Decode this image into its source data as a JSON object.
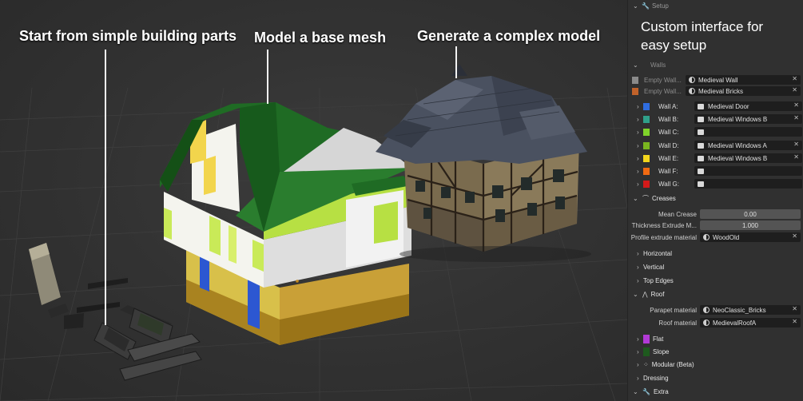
{
  "captions": {
    "parts": "Start from simple building parts",
    "mesh": "Model a base mesh",
    "complex": "Generate a complex model",
    "interface_line1": "Custom interface for",
    "interface_line2": "easy setup"
  },
  "panel": {
    "setup_header": "Setup",
    "walls_header": "Walls",
    "empty_rows": [
      {
        "label": "Empty Wall...",
        "value": "Medieval Wall",
        "color": "#8a8a8a"
      },
      {
        "label": "Empty Wall...",
        "value": "Medieval Bricks",
        "color": "#c0622a"
      }
    ],
    "walls": [
      {
        "label": "Wall A:",
        "value": "Medieval Door",
        "color": "#2f6de0"
      },
      {
        "label": "Wall B:",
        "value": "Medieval Windows B",
        "color": "#2fa08a"
      },
      {
        "label": "Wall C:",
        "value": "",
        "color": "#7fd42a"
      },
      {
        "label": "Wall D:",
        "value": "Medieval Windows A",
        "color": "#7ab51f"
      },
      {
        "label": "Wall E:",
        "value": "Medieval Windows B",
        "color": "#f2d51c"
      },
      {
        "label": "Wall F:",
        "value": "",
        "color": "#f06a12"
      },
      {
        "label": "Wall G:",
        "value": "",
        "color": "#d41a1a"
      }
    ],
    "creases": {
      "header": "Creases",
      "mean_crease_label": "Mean Crease",
      "mean_crease_value": "0.00",
      "thickness_label": "Thickness Extrude M...",
      "thickness_value": "1.000",
      "profile_label": "Profile extrude material",
      "profile_value": "WoodOld"
    },
    "sub_sections": [
      "Horizontal",
      "Vertical",
      "Top Edges"
    ],
    "roof": {
      "header": "Roof",
      "parapet_label": "Parapet material",
      "parapet_value": "NeoClassic_Bricks",
      "roof_label": "Roof material",
      "roof_value": "MedievalRoofA",
      "flat_label": "Flat",
      "flat_color": "#b23ad6",
      "slope_label": "Slope",
      "slope_color": "#1e5a1e",
      "modular_label": "Modular (Beta)",
      "dressing_label": "Dressing"
    },
    "extra_header": "Extra"
  }
}
